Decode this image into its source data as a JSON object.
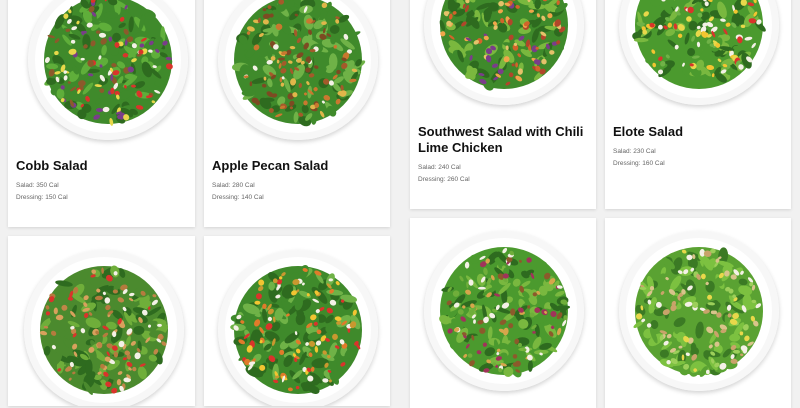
{
  "colors": {
    "page_background": "#f1f1f1",
    "card_background": "#ffffff",
    "title_text": "#111111",
    "nutrition_text": "#666666"
  },
  "menu": {
    "items": [
      {
        "name": "Cobb Salad",
        "salad_cal": "Salad: 350 Cal",
        "dressing_cal": "Dressing: 150 Cal",
        "image": "cobb-salad-photo"
      },
      {
        "name": "Apple Pecan Salad",
        "salad_cal": "Salad: 280 Cal",
        "dressing_cal": "Dressing: 140 Cal",
        "image": "apple-pecan-salad-photo"
      },
      {
        "name": "Southwest Salad with Chili Lime Chicken",
        "salad_cal": "Salad: 240 Cal",
        "dressing_cal": "Dressing: 260 Cal",
        "image": "southwest-salad-photo"
      },
      {
        "name": "Elote Salad",
        "salad_cal": "Salad: 230 Cal",
        "dressing_cal": "Dressing: 160 Cal",
        "image": "elote-salad-photo"
      },
      {
        "name": "",
        "salad_cal": "",
        "dressing_cal": "",
        "image": "pasta-salad-photo"
      },
      {
        "name": "",
        "salad_cal": "",
        "dressing_cal": "",
        "image": "chopped-salad-photo"
      },
      {
        "name": "",
        "salad_cal": "",
        "dressing_cal": "",
        "image": "greek-salad-photo"
      },
      {
        "name": "",
        "salad_cal": "",
        "dressing_cal": "",
        "image": "chicken-caesar-salad-photo"
      }
    ]
  }
}
